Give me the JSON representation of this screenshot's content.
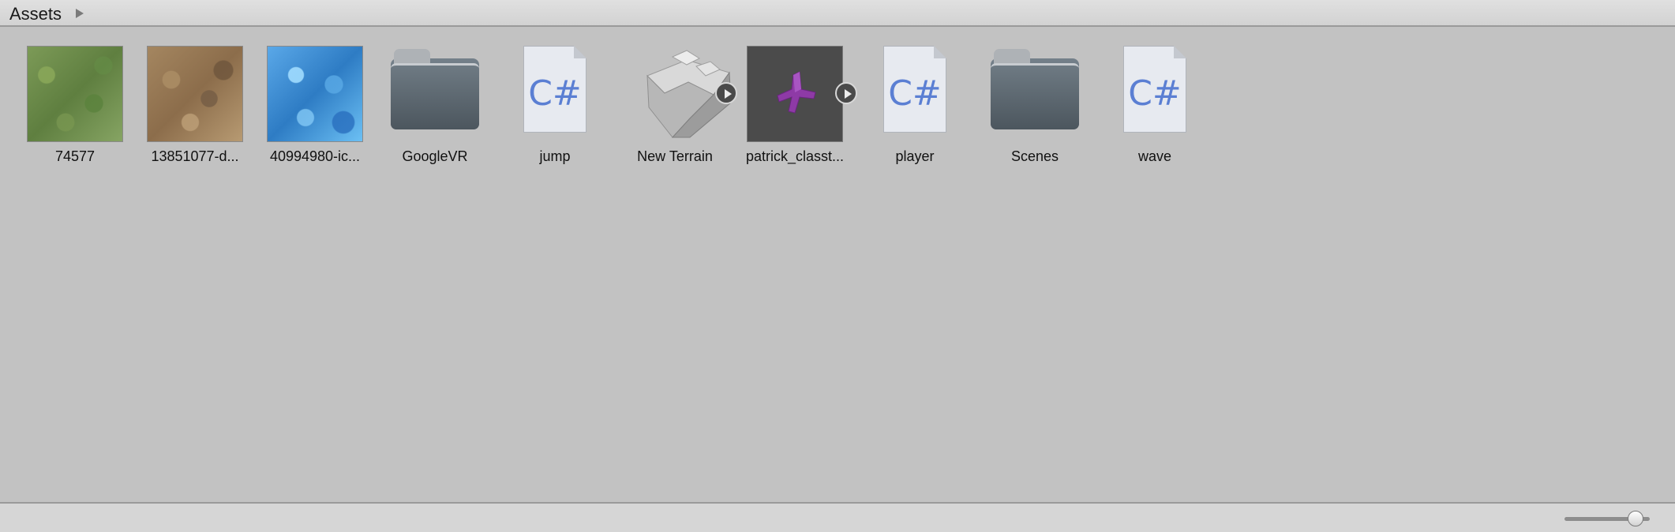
{
  "breadcrumb": {
    "label": "Assets"
  },
  "assets": [
    {
      "name": "74577",
      "type": "texture",
      "icon": "grass-texture"
    },
    {
      "name": "13851077-d...",
      "type": "texture",
      "icon": "dirt-texture"
    },
    {
      "name": "40994980-ic...",
      "type": "texture",
      "icon": "water-texture"
    },
    {
      "name": "GoogleVR",
      "type": "folder",
      "icon": "folder-icon"
    },
    {
      "name": "jump",
      "type": "script",
      "icon": "csharp-script-icon",
      "glyph": "C#"
    },
    {
      "name": "New Terrain",
      "type": "terrain",
      "icon": "terrain-icon"
    },
    {
      "name": "patrick_classt...",
      "type": "model",
      "icon": "model-icon"
    },
    {
      "name": "player",
      "type": "script",
      "icon": "csharp-script-icon",
      "glyph": "C#"
    },
    {
      "name": "Scenes",
      "type": "folder",
      "icon": "folder-icon"
    },
    {
      "name": "wave",
      "type": "script",
      "icon": "csharp-script-icon",
      "glyph": "C#"
    }
  ],
  "zoom_slider": {
    "value": 0.83
  },
  "colors": {
    "background": "#c2c2c2",
    "toolbar": "#d6d6d6",
    "script_text": "#5b7fd3",
    "model": "#8e3aa6"
  }
}
